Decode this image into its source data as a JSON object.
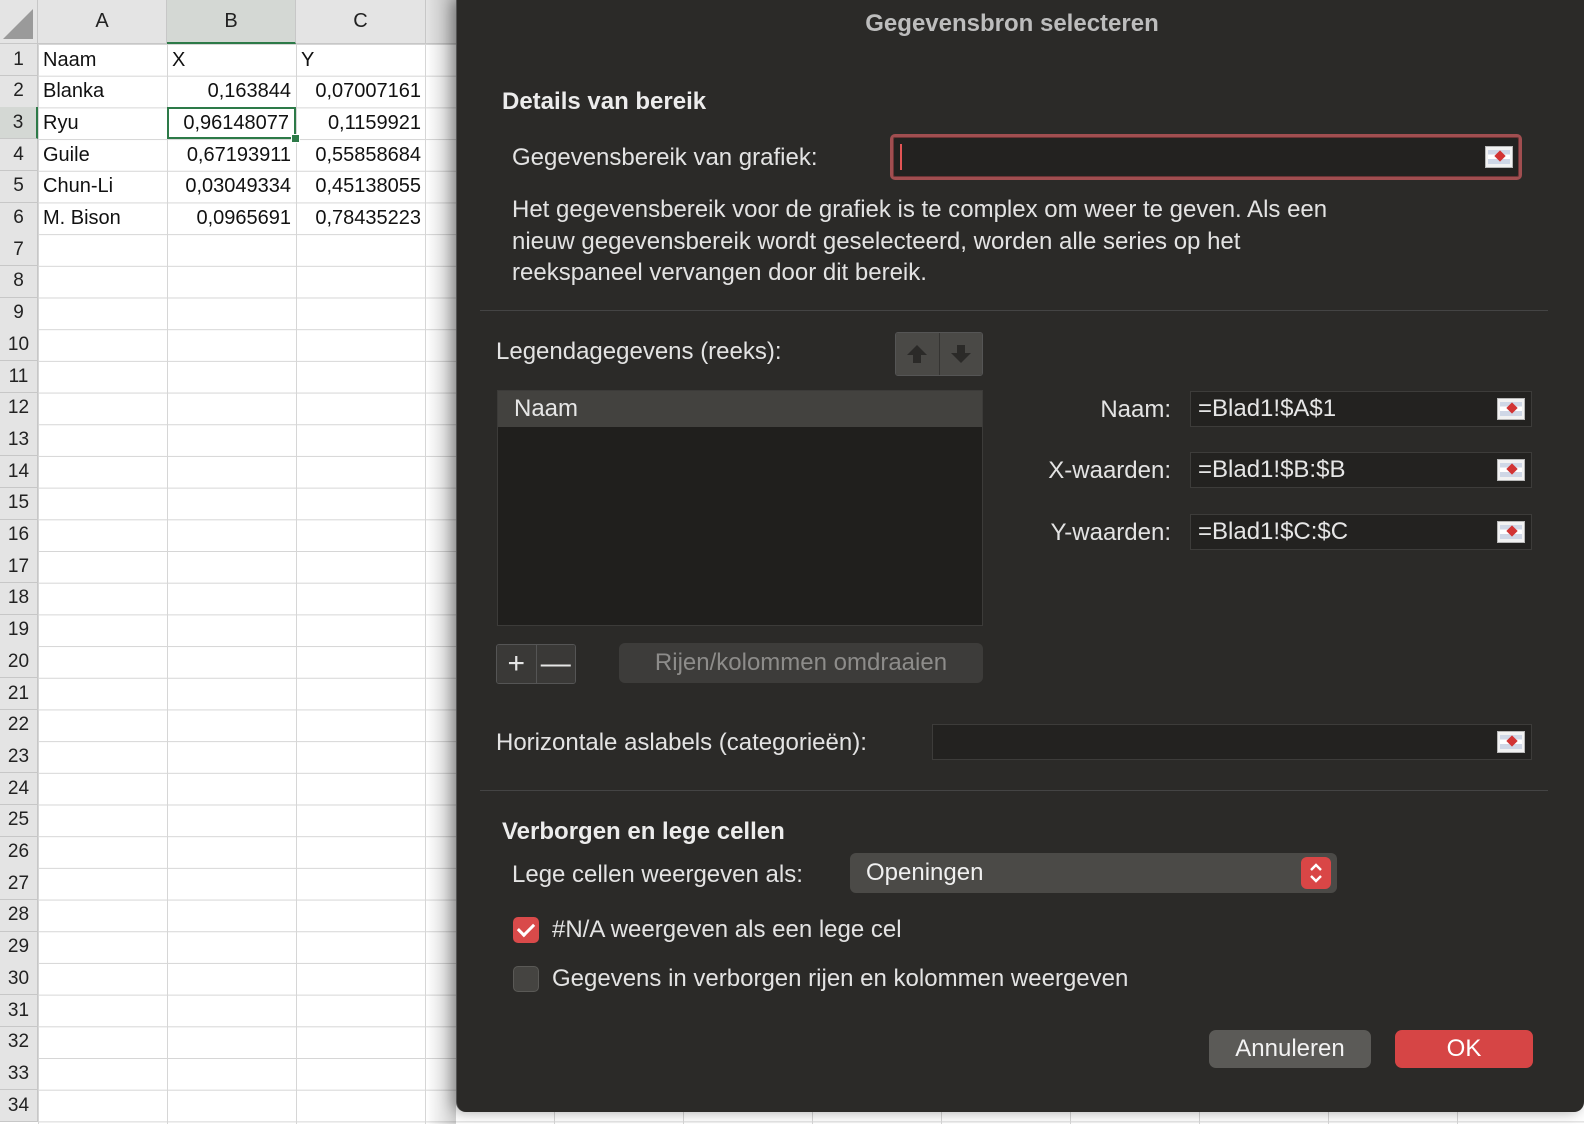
{
  "spreadsheet": {
    "columns": [
      "A",
      "B",
      "C"
    ],
    "selected_column": "B",
    "selected_row": "3",
    "row_numbers": [
      "1",
      "2",
      "3",
      "4",
      "5",
      "6",
      "7",
      "8",
      "9",
      "10",
      "11",
      "12",
      "13",
      "14",
      "15",
      "16",
      "17",
      "18",
      "19",
      "20",
      "21",
      "22",
      "23",
      "24",
      "25",
      "26",
      "27",
      "28",
      "29",
      "30",
      "31",
      "32",
      "33",
      "34"
    ],
    "rows": [
      {
        "a": "Naam",
        "b": "X",
        "c": "Y"
      },
      {
        "a": "Blanka",
        "b": "0,163844",
        "c": "0,07007161"
      },
      {
        "a": "Ryu",
        "b": "0,96148077",
        "c": "0,1159921"
      },
      {
        "a": "Guile",
        "b": "0,67193911",
        "c": "0,55858684"
      },
      {
        "a": "Chun-Li",
        "b": "0,03049334",
        "c": "0,45138055"
      },
      {
        "a": "M. Bison",
        "b": "0,0965691",
        "c": "0,78435223"
      }
    ]
  },
  "dialog": {
    "title": "Gegevensbron selecteren",
    "range_section": {
      "heading": "Details van bereik",
      "chart_range_label": "Gegevensbereik van grafiek:",
      "chart_range_value": "",
      "description": "Het gegevensbereik voor de grafiek is te complex om weer te geven. Als een nieuw gegevensbereik wordt geselecteerd, worden alle series op het reekspaneel vervangen door dit bereik."
    },
    "legend": {
      "label": "Legendagegevens (reeks):",
      "items": [
        "Naam"
      ],
      "add_label": "+",
      "remove_label": "—",
      "switch_label": "Rijen/kolommen omdraaien"
    },
    "series_fields": {
      "name_label": "Naam:",
      "name_value": "=Blad1!$A$1",
      "x_label": "X-waarden:",
      "x_value": "=Blad1!$B:$B",
      "y_label": "Y-waarden:",
      "y_value": "=Blad1!$C:$C"
    },
    "axis_labels": {
      "label": "Horizontale aslabels (categorieën):",
      "value": ""
    },
    "hidden_section": {
      "heading": "Verborgen en lege cellen",
      "empty_cells_label": "Lege cellen weergeven als:",
      "empty_cells_value": "Openingen",
      "na_checkbox_label": "#N/A weergeven als een lege cel",
      "na_checked": true,
      "hidden_checkbox_label": "Gegevens in verborgen rijen en kolommen weergeven",
      "hidden_checked": false
    },
    "buttons": {
      "cancel": "Annuleren",
      "ok": "OK"
    }
  },
  "colors": {
    "dialog_bg": "#2b2a28",
    "accent_red": "#d64545",
    "selection_green": "#2d7a48"
  }
}
